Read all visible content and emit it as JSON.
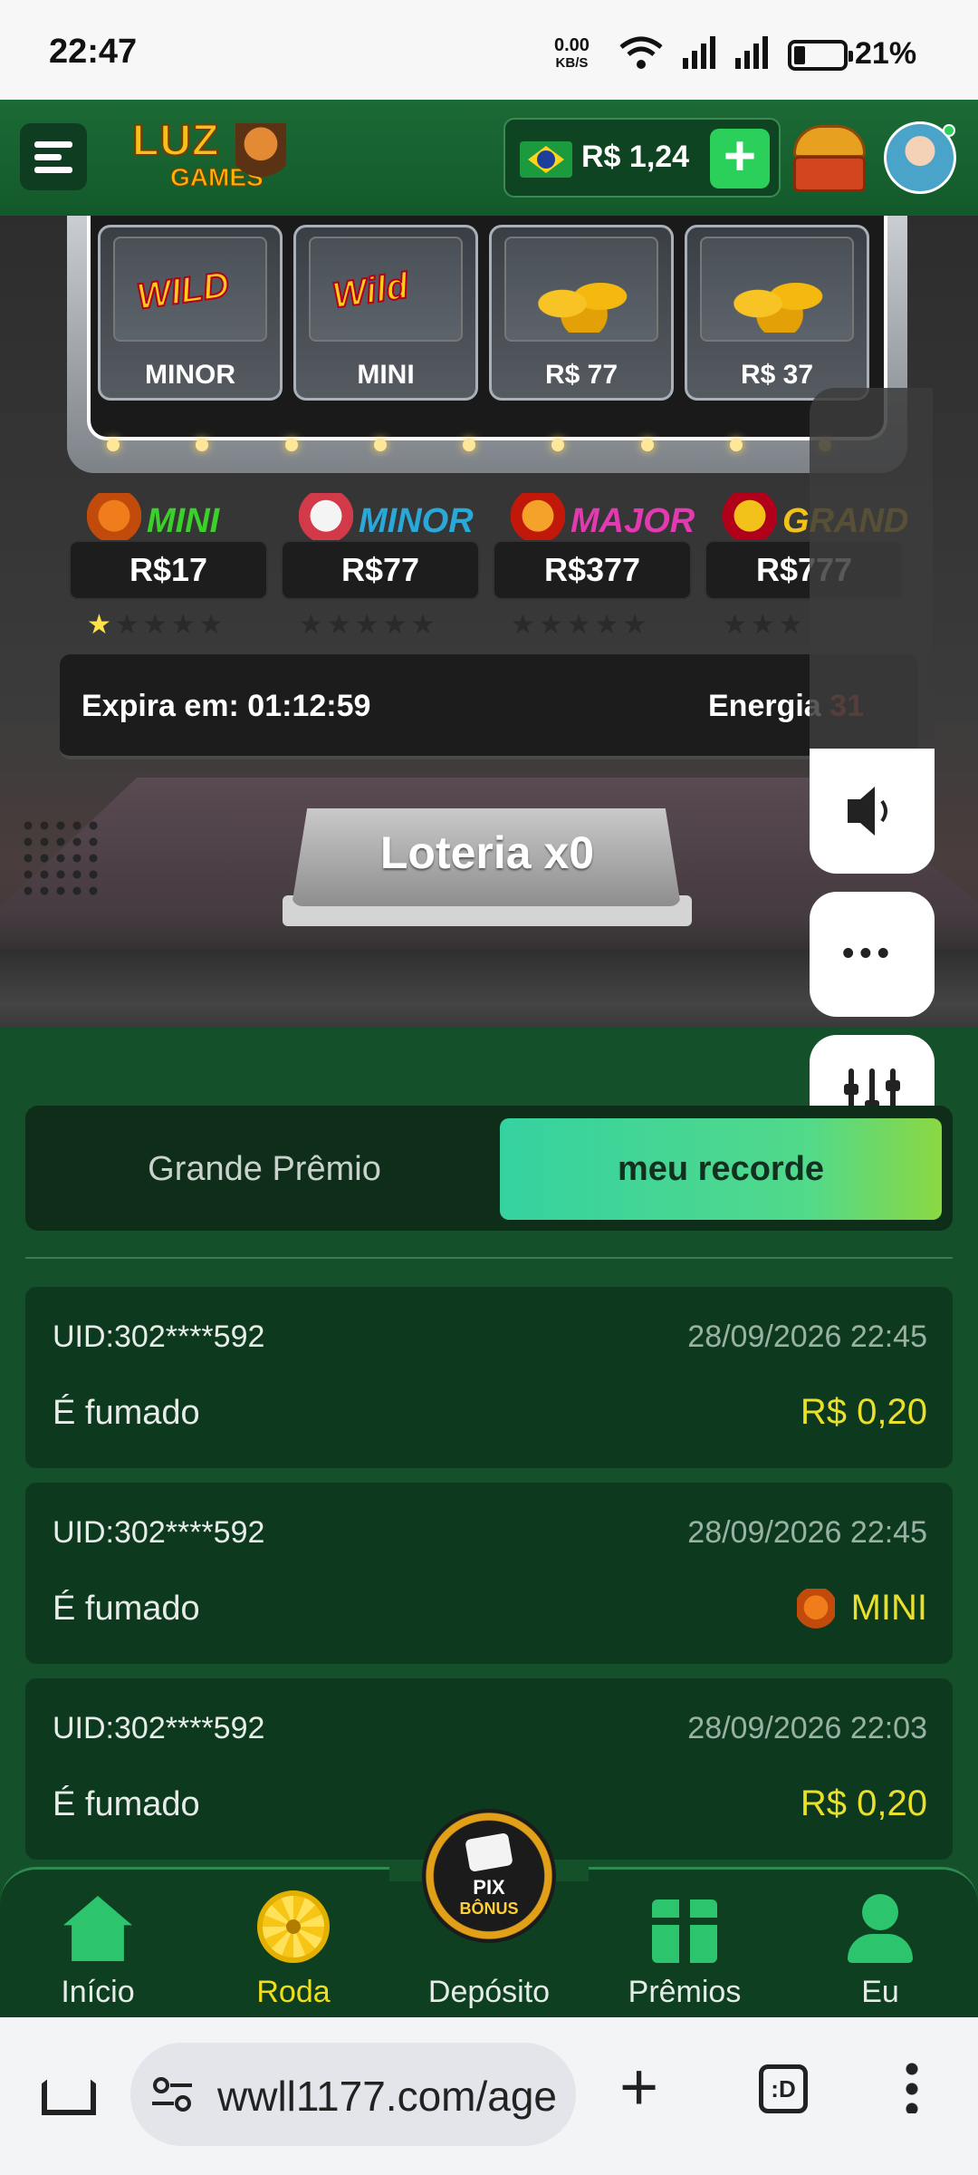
{
  "status_bar": {
    "time": "22:47",
    "net_speed_value": "0.00",
    "net_speed_unit": "KB/S",
    "battery": "21%"
  },
  "header": {
    "logo_line1": "LUZ",
    "logo_line2": "GAMES",
    "balance": "R$ 1,24",
    "add_label": "+"
  },
  "reels": [
    {
      "symbol": "WILD",
      "label": "MINOR",
      "icon": "wild-rabbit-icon"
    },
    {
      "symbol": "Wild",
      "label": "MINI",
      "icon": "wild-dragon-icon"
    },
    {
      "symbol": "",
      "label": "R$ 77",
      "icon": "gold-coins-icon"
    },
    {
      "symbol": "",
      "label": "R$ 37",
      "icon": "gold-coins-icon"
    }
  ],
  "jackpots": [
    {
      "name": "MINI",
      "value": "R$17",
      "stars_filled": 1,
      "stars_empty": "★★★★",
      "stars_on": "★",
      "color": "#3cd02a"
    },
    {
      "name": "MINOR",
      "value": "R$77",
      "stars_filled": 0,
      "stars_empty": "★★★★★",
      "stars_on": "",
      "color": "#2aa8d8"
    },
    {
      "name": "MAJOR",
      "value": "R$377",
      "stars_filled": 0,
      "stars_empty": "★★★★★",
      "stars_on": "",
      "color": "#e23ab0"
    },
    {
      "name": "GRAND",
      "value": "R$777",
      "stars_filled": 0,
      "stars_empty": "★★★",
      "stars_on": "",
      "color": "#f2c21a"
    }
  ],
  "expiry": {
    "label": "Expira em: 01:12:59",
    "energy_label": "Energia",
    "energy_value": "31"
  },
  "lottery_button": "Loteria x0",
  "side_widget": {
    "more": "•••"
  },
  "tabs": {
    "grand_prize": "Grande Prêmio",
    "my_record": "meu recorde"
  },
  "records": [
    {
      "uid": "UID:302****592",
      "date": "28/09/2026 22:45",
      "desc": "É fumado",
      "prize": "R$ 0,20",
      "has_icon": false
    },
    {
      "uid": "UID:302****592",
      "date": "28/09/2026 22:45",
      "desc": "É fumado",
      "prize": "MINI",
      "has_icon": true
    },
    {
      "uid": "UID:302****592",
      "date": "28/09/2026 22:03",
      "desc": "É fumado",
      "prize": "R$ 0,20",
      "has_icon": false
    }
  ],
  "bottom_nav": {
    "home": "Início",
    "wheel": "Roda",
    "deposit": "Depósito",
    "prizes": "Prêmios",
    "me": "Eu",
    "deposit_badge_line1": "PIX",
    "deposit_badge_line2": "BÔNUS"
  },
  "browser": {
    "url": "wwll1177.com/age",
    "tabs_count": ":D"
  }
}
